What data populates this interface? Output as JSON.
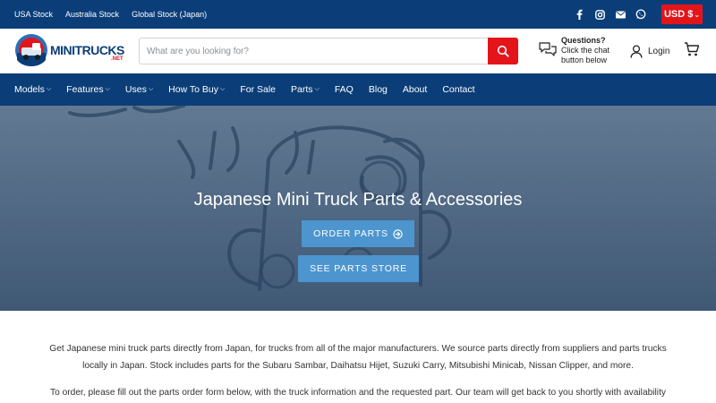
{
  "topbar": {
    "links": [
      "USA Stock",
      "Australia Stock",
      "Global Stock (Japan)"
    ],
    "social": [
      "facebook-icon",
      "instagram-icon",
      "mail-icon",
      "whatsapp-icon"
    ],
    "currency": "USD $"
  },
  "header": {
    "logo_text": "MINITRUCKS",
    "logo_suffix": ".NET",
    "search_placeholder": "What are you looking for?",
    "questions_title": "Questions?",
    "questions_body": "Click the chat button below",
    "login_label": "Login"
  },
  "nav": {
    "items": [
      {
        "label": "Models",
        "dropdown": true
      },
      {
        "label": "Features",
        "dropdown": true
      },
      {
        "label": "Uses",
        "dropdown": true
      },
      {
        "label": "How To Buy",
        "dropdown": true
      },
      {
        "label": "For Sale",
        "dropdown": false
      },
      {
        "label": "Parts",
        "dropdown": true
      },
      {
        "label": "FAQ",
        "dropdown": false
      },
      {
        "label": "Blog",
        "dropdown": false
      },
      {
        "label": "About",
        "dropdown": false
      },
      {
        "label": "Contact",
        "dropdown": false
      }
    ]
  },
  "hero": {
    "title": "Japanese Mini Truck Parts & Accessories",
    "order_button": "ORDER PARTS",
    "store_button": "SEE PARTS STORE"
  },
  "content": {
    "paragraph1": "Get Japanese mini truck parts directly from Japan, for trucks from all of the major manufacturers. We source parts directly from suppliers and parts trucks locally in Japan. Stock includes parts for the Subaru Sambar, Daihatsu Hijet, Suzuki Carry, Mitsubishi Minicab, Nissan Clipper, and more.",
    "paragraph2": "To order, please fill out the parts order form below, with the truck information and the requested part. Our team will get back to you shortly with availability"
  },
  "colors": {
    "brand_blue": "#0b3e78",
    "accent_red": "#e4141b",
    "button_blue": "#4d95cf"
  }
}
